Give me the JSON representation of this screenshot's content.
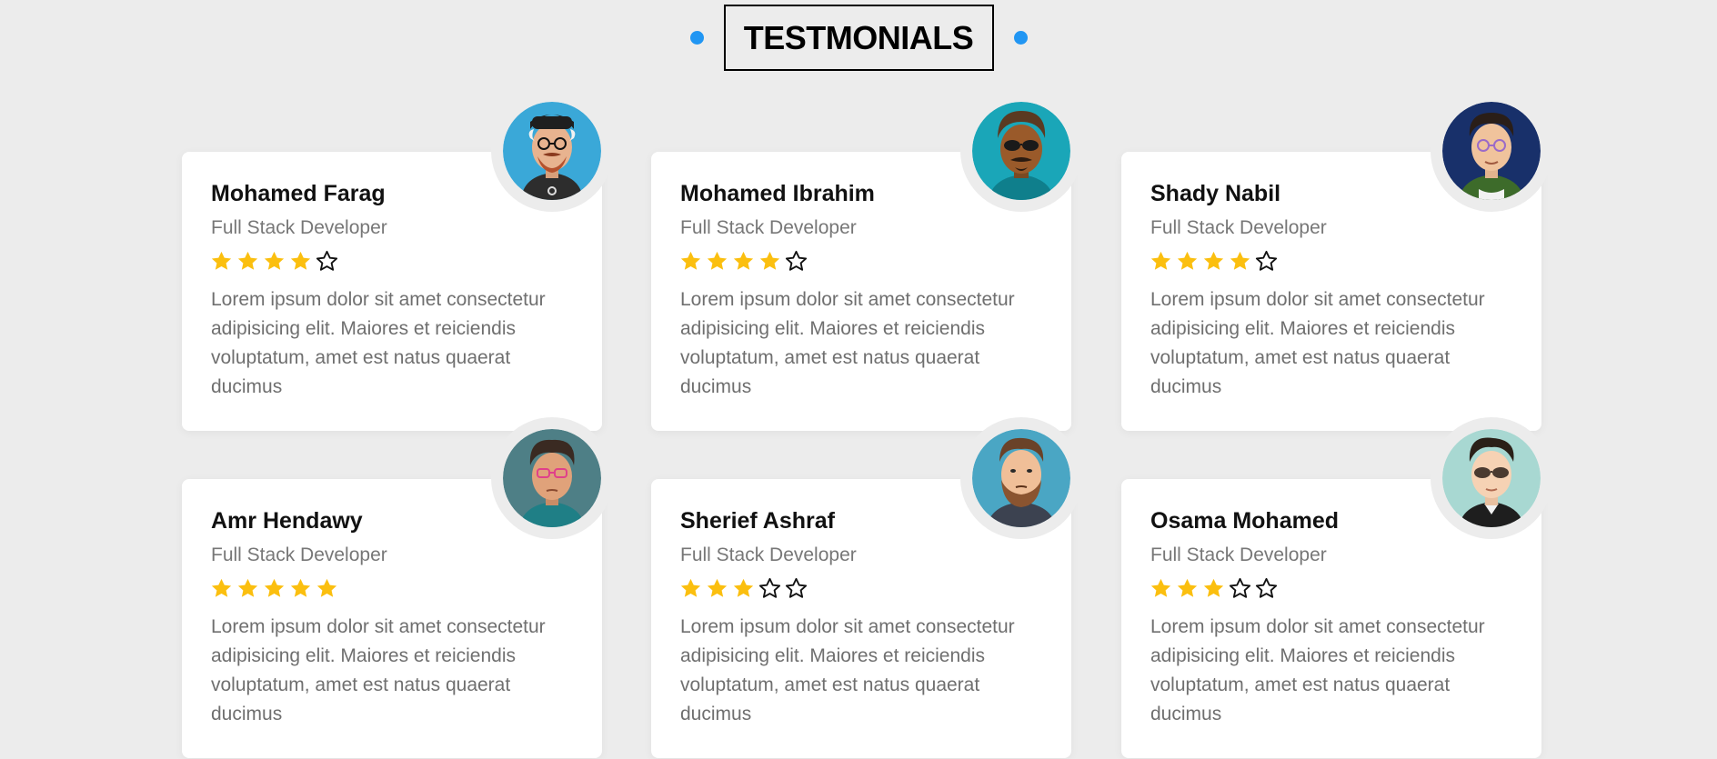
{
  "section": {
    "title": "TESTMONIALS"
  },
  "colors": {
    "accent": "#2196f3",
    "star": "#fbbf0f",
    "background": "#ececec"
  },
  "testimonials": [
    {
      "name": "Mohamed Farag",
      "role": "Full Stack Developer",
      "rating": 4,
      "text": "Lorem ipsum dolor sit amet consectetur adipisicing elit. Maiores et reiciendis voluptatum, amet est natus quaerat ducimus",
      "avatar": "avatar-1"
    },
    {
      "name": "Mohamed Ibrahim",
      "role": "Full Stack Developer",
      "rating": 4,
      "text": "Lorem ipsum dolor sit amet consectetur adipisicing elit. Maiores et reiciendis voluptatum, amet est natus quaerat ducimus",
      "avatar": "avatar-2"
    },
    {
      "name": "Shady Nabil",
      "role": "Full Stack Developer",
      "rating": 4,
      "text": "Lorem ipsum dolor sit amet consectetur adipisicing elit. Maiores et reiciendis voluptatum, amet est natus quaerat ducimus",
      "avatar": "avatar-3"
    },
    {
      "name": "Amr Hendawy",
      "role": "Full Stack Developer",
      "rating": 5,
      "text": "Lorem ipsum dolor sit amet consectetur adipisicing elit. Maiores et reiciendis voluptatum, amet est natus quaerat ducimus",
      "avatar": "avatar-4"
    },
    {
      "name": "Sherief Ashraf",
      "role": "Full Stack Developer",
      "rating": 3,
      "text": "Lorem ipsum dolor sit amet consectetur adipisicing elit. Maiores et reiciendis voluptatum, amet est natus quaerat ducimus",
      "avatar": "avatar-5"
    },
    {
      "name": "Osama Mohamed",
      "role": "Full Stack Developer",
      "rating": 3,
      "text": "Lorem ipsum dolor sit amet consectetur adipisicing elit. Maiores et reiciendis voluptatum, amet est natus quaerat ducimus",
      "avatar": "avatar-6"
    }
  ]
}
